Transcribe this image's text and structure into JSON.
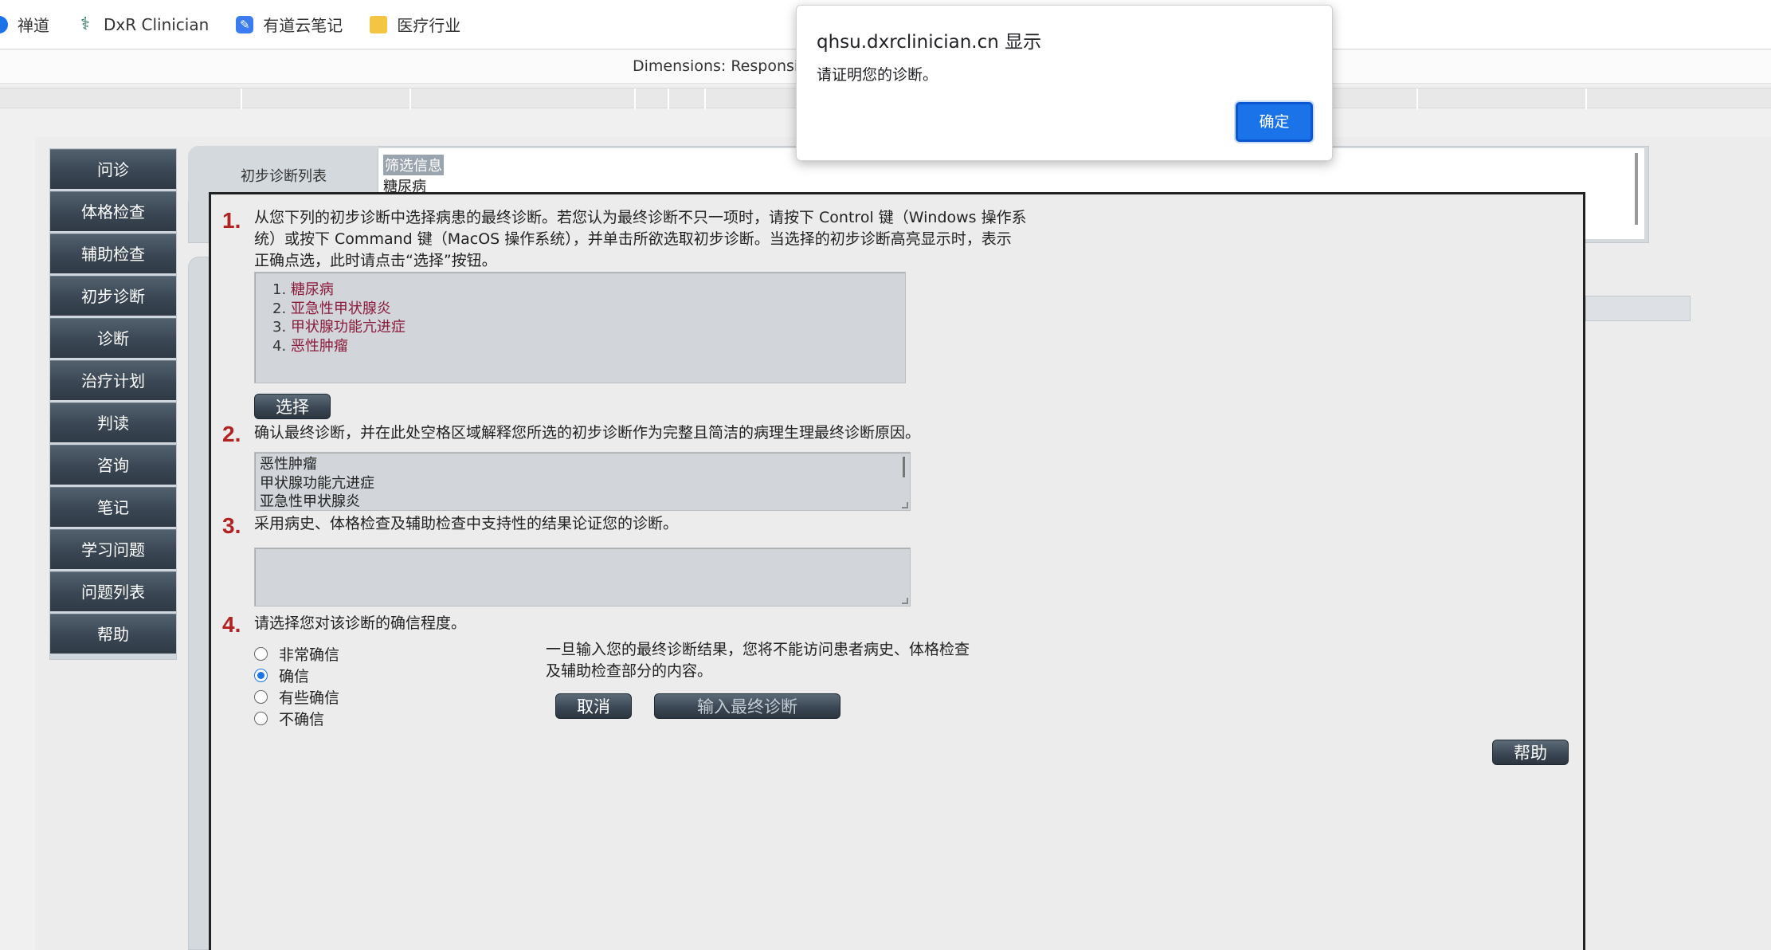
{
  "bookmarks": [
    {
      "label": "禅道",
      "icon": "chandao-icon"
    },
    {
      "label": "DxR Clinician",
      "icon": "dxr-icon"
    },
    {
      "label": "有道云笔记",
      "icon": "youdao-note-icon"
    },
    {
      "label": "医疗行业",
      "icon": "folder-icon"
    }
  ],
  "dimensions_bar": {
    "text": "Dimensions: Responsive"
  },
  "sidenav": {
    "items": [
      "问诊",
      "体格检查",
      "辅助检查",
      "初步诊断",
      "诊断",
      "治疗计划",
      "判读",
      "咨询",
      "笔记",
      "学习问题",
      "问题列表",
      "帮助"
    ]
  },
  "background": {
    "tab_label": "初步诊断列表",
    "filter_title": "筛选信息",
    "filter_item": "糖尿病"
  },
  "dialog": {
    "step1": {
      "num": "1.",
      "line1": "从您下列的初步诊断中选择病患的最终诊断。若您认为最终诊断不只一项时，请按下 Control 键（Windows 操作系",
      "line2": "统）或按下 Command 键（MacOS 操作系统），并单击所欲选取初步诊断。当选择的初步诊断高亮显示时，表示",
      "line3": "正确点选，此时请点击“选择”按钮。",
      "list": [
        {
          "n": "1.",
          "dx": "糖尿病"
        },
        {
          "n": "2.",
          "dx": "亚急性甲状腺炎"
        },
        {
          "n": "3.",
          "dx": "甲状腺功能亢进症"
        },
        {
          "n": "4.",
          "dx": "恶性肿瘤"
        }
      ],
      "select_button": "选择"
    },
    "step2": {
      "num": "2.",
      "text": "确认最终诊断，并在此处空格区域解释您所选的初步诊断作为完整且简洁的病理生理最终诊断原因。",
      "lines": [
        "恶性肿瘤",
        "甲状腺功能亢进症",
        "亚急性甲状腺炎"
      ]
    },
    "step3": {
      "num": "3.",
      "text": "采用病史、体格检查及辅助检查中支持性的结果论证您的诊断。",
      "value": ""
    },
    "step4": {
      "num": "4.",
      "text": "请选择您对该诊断的确信程度。",
      "options": [
        "非常确信",
        "确信",
        "有些确信",
        "不确信"
      ],
      "selected_index": 1
    },
    "warning_line1": "一旦输入您的最终诊断结果，您将不能访问患者病史、体格检查",
    "warning_line2": "及辅助检查部分的内容。",
    "cancel_button": "取消",
    "enter_button": "输入最终诊断",
    "help_button": "帮助"
  },
  "alert": {
    "host": "qhsu.dxrclinician.cn 显示",
    "message": "请证明您的诊断。",
    "ok_button": "确定",
    "ok_color": "#1a73e8"
  }
}
